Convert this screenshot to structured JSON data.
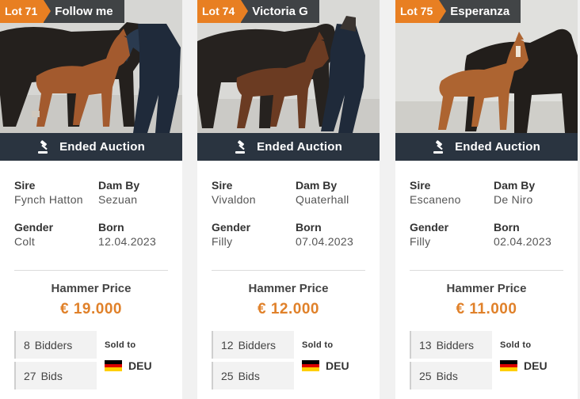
{
  "lots": [
    {
      "lot_label": "Lot 71",
      "name": "Follow me",
      "status": "Ended Auction",
      "sire_label": "Sire",
      "sire": "Fynch Hatton",
      "dam_label": "Dam By",
      "dam_by": "Sezuan",
      "gender_label": "Gender",
      "gender": "Colt",
      "born_label": "Born",
      "born": "12.04.2023",
      "price_label": "Hammer Price",
      "price": "€ 19.000",
      "bidders_count": "8",
      "bidders_label": "Bidders",
      "bids_count": "27",
      "bids_label": "Bids",
      "sold_label": "Sold to",
      "country": "DEU"
    },
    {
      "lot_label": "Lot 74",
      "name": "Victoria G",
      "status": "Ended Auction",
      "sire_label": "Sire",
      "sire": "Vivaldon",
      "dam_label": "Dam By",
      "dam_by": "Quaterhall",
      "gender_label": "Gender",
      "gender": "Filly",
      "born_label": "Born",
      "born": "07.04.2023",
      "price_label": "Hammer Price",
      "price": "€ 12.000",
      "bidders_count": "12",
      "bidders_label": "Bidders",
      "bids_count": "25",
      "bids_label": "Bids",
      "sold_label": "Sold to",
      "country": "DEU"
    },
    {
      "lot_label": "Lot 75",
      "name": "Esperanza",
      "status": "Ended Auction",
      "sire_label": "Sire",
      "sire": "Escaneno",
      "dam_label": "Dam By",
      "dam_by": "De Niro",
      "gender_label": "Gender",
      "gender": "Filly",
      "born_label": "Born",
      "born": "02.04.2023",
      "price_label": "Hammer Price",
      "price": "€ 11.000",
      "bidders_count": "13",
      "bidders_label": "Bidders",
      "bids_count": "25",
      "bids_label": "Bids",
      "sold_label": "Sold to",
      "country": "DEU"
    }
  ],
  "colors": {
    "accent": "#e87f22",
    "price": "#e0812a",
    "status_bar": "#2a3440",
    "flag_de": [
      "#000000",
      "#dd0000",
      "#ffce00"
    ]
  },
  "icons": {
    "status": "gavel-icon",
    "country": "germany-flag-icon"
  }
}
